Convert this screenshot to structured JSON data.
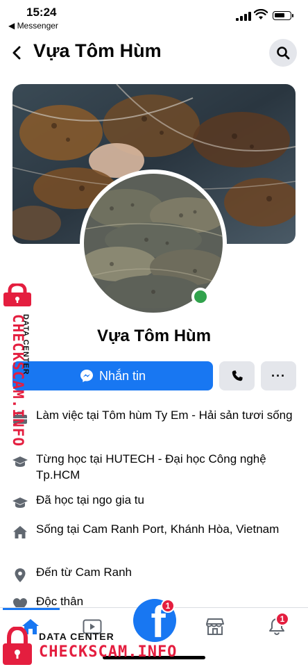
{
  "status_bar": {
    "time": "15:24",
    "back_app": "◀ Messenger",
    "battery_level": 0.7
  },
  "header": {
    "title": "Vựa Tôm Hùm"
  },
  "profile": {
    "name": "Vựa Tôm Hùm",
    "online": true
  },
  "actions": {
    "message_label": "Nhắn tin",
    "more_label": "···"
  },
  "details": [
    {
      "icon": "briefcase-icon",
      "text": "Làm việc tại Tôm hùm Ty Em - Hải sản tươi sống"
    },
    {
      "icon": "graduation-cap-icon",
      "text": "Từng học tại HUTECH - Đại học Công nghệ Tp.HCM"
    },
    {
      "icon": "graduation-cap-icon",
      "text": "Đã học tại ngo gia tu"
    },
    {
      "icon": "home-icon",
      "text": "Sống tại Cam Ranh Port, Khánh Hòa, Vietnam"
    },
    {
      "icon": "location-pin-icon",
      "text": "Đến từ Cam Ranh"
    },
    {
      "icon": "heart-icon",
      "text": "Độc thân"
    }
  ],
  "bottom_nav": {
    "active": "home",
    "badges": {
      "facebook": "1",
      "notifications": "1"
    },
    "facebook_logo": "f"
  },
  "watermark": {
    "brand": "CHECKSCAM.INFO",
    "tagline": "DATA CENTER"
  },
  "colors": {
    "accent": "#1877f2",
    "online": "#31a24c",
    "badge": "#e41e3f",
    "watermark": "#e41e3f"
  }
}
